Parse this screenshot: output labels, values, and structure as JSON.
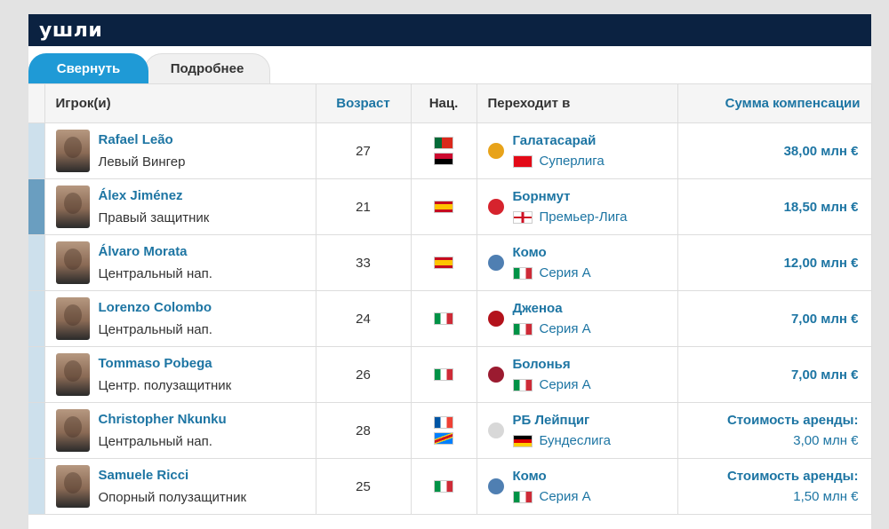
{
  "section_title": "ушли",
  "tabs": {
    "active": "Свернуть",
    "inactive": "Подробнее"
  },
  "columns": {
    "player": "Игрок(и)",
    "age": "Возраст",
    "nat": "Нац.",
    "moves_to": "Переходит в",
    "fee": "Сумма компенсации"
  },
  "rows": [
    {
      "name": "Rafael Leão",
      "position": "Левый Вингер",
      "age": "27",
      "flags": [
        "portugal-flag",
        "angola-flag"
      ],
      "club": "Галатасарай",
      "league": "Суперлига",
      "league_flag": "turkey-flag",
      "fee": "38,00 млн €",
      "fee_sub": ""
    },
    {
      "name": "Álex Jiménez",
      "position": "Правый защитник",
      "age": "21",
      "flags": [
        "spain-flag"
      ],
      "club": "Борнмут",
      "league": "Премьер-Лига",
      "league_flag": "england-flag",
      "fee": "18,50 млн €",
      "fee_sub": ""
    },
    {
      "name": "Álvaro Morata",
      "position": "Центральный нап.",
      "age": "33",
      "flags": [
        "spain-flag"
      ],
      "club": "Комо",
      "league": "Серия А",
      "league_flag": "italy-flag",
      "fee": "12,00 млн €",
      "fee_sub": ""
    },
    {
      "name": "Lorenzo Colombo",
      "position": "Центральный нап.",
      "age": "24",
      "flags": [
        "italy-flag"
      ],
      "club": "Дженоа",
      "league": "Серия А",
      "league_flag": "italy-flag",
      "fee": "7,00 млн €",
      "fee_sub": ""
    },
    {
      "name": "Tommaso Pobega",
      "position": "Центр. полузащитник",
      "age": "26",
      "flags": [
        "italy-flag"
      ],
      "club": "Болонья",
      "league": "Серия А",
      "league_flag": "italy-flag",
      "fee": "7,00 млн €",
      "fee_sub": ""
    },
    {
      "name": "Christopher Nkunku",
      "position": "Центральный нап.",
      "age": "28",
      "flags": [
        "france-flag",
        "dr-congo-flag"
      ],
      "club": "РБ Лейпциг",
      "league": "Бундеслига",
      "league_flag": "germany-flag",
      "fee": "Стоимость аренды:",
      "fee_sub": "3,00 млн €"
    },
    {
      "name": "Samuele Ricci",
      "position": "Опорный полузащитник",
      "age": "25",
      "flags": [
        "italy-flag"
      ],
      "club": "Комо",
      "league": "Серия А",
      "league_flag": "italy-flag",
      "fee": "Стоимость аренды:",
      "fee_sub": "1,50 млн €"
    }
  ],
  "colors": {
    "header_bg": "#0b2241",
    "tab_active": "#1f9ad6",
    "link": "#1d75a3"
  }
}
